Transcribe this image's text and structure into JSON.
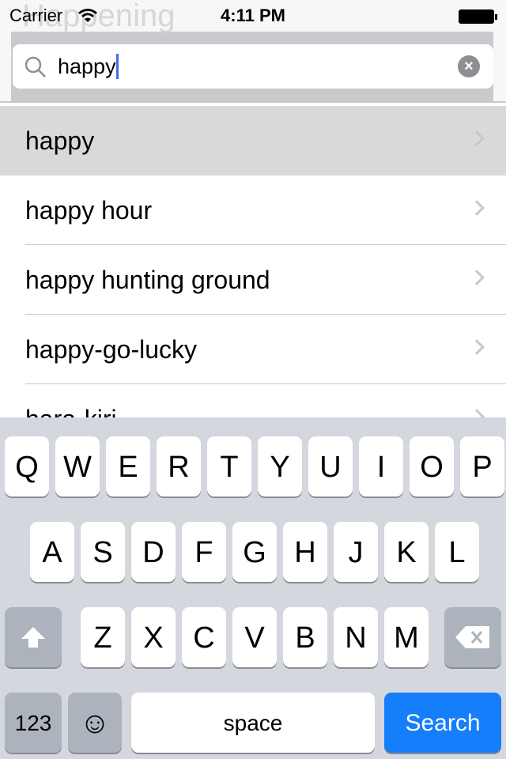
{
  "background_title": "Happening",
  "status_bar": {
    "carrier": "Carrier",
    "time": "4:11 PM",
    "wifi_icon": "wifi-icon",
    "battery_icon": "battery-icon"
  },
  "search": {
    "value": "happy",
    "search_icon": "search-icon",
    "clear_icon": "clear-icon"
  },
  "results": [
    "happy",
    "happy hour",
    "happy hunting ground",
    "happy-go-lucky",
    "hara-kiri"
  ],
  "keyboard": {
    "row1": [
      "Q",
      "W",
      "E",
      "R",
      "T",
      "Y",
      "U",
      "I",
      "O",
      "P"
    ],
    "row2": [
      "A",
      "S",
      "D",
      "F",
      "G",
      "H",
      "J",
      "K",
      "L"
    ],
    "row3": [
      "Z",
      "X",
      "C",
      "V",
      "B",
      "N",
      "M"
    ],
    "numbers": "123",
    "emoji": "☺",
    "space": "space",
    "search": "Search",
    "accent": "#147efb"
  }
}
